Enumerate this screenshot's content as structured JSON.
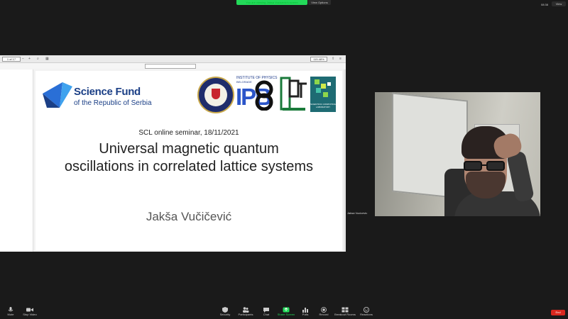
{
  "top": {
    "banner_text": "You are viewing Jaksa Vucicevic's screen",
    "view_options": "View Options",
    "clock": "08:38",
    "view_button": "View"
  },
  "viewer": {
    "page_indicator": "1 of 17",
    "zoom": "115.48%"
  },
  "slide": {
    "funder_line1": "Science Fund",
    "funder_line2": "of the Republic of Serbia",
    "ipb_line1": "INSTITUTE OF PHYSICS",
    "ipb_line2": "BELGRADE",
    "ipb_logo": "IPB",
    "scl_logo": "SCIENTIFIC COMPUTING LABORATORY",
    "seminar": "SCL online seminar, 18/11/2021",
    "title": "Universal magnetic quantum oscillations in correlated lattice systems",
    "author": "Jakša Vučičević"
  },
  "participant": {
    "name": "Jaksa Vucicevic"
  },
  "toolbar": {
    "mute": "Mute",
    "video": "Stop Video",
    "security": "Security",
    "participants": "Participants",
    "chat": "Chat",
    "share": "Share Screen",
    "polls": "Polls",
    "record": "Record",
    "breakout": "Breakout Rooms",
    "reactions": "Reactions",
    "end": "End"
  },
  "colors": {
    "share_green": "#23d959",
    "end_red": "#d9281f",
    "funder_blue": "#1b3f86"
  }
}
